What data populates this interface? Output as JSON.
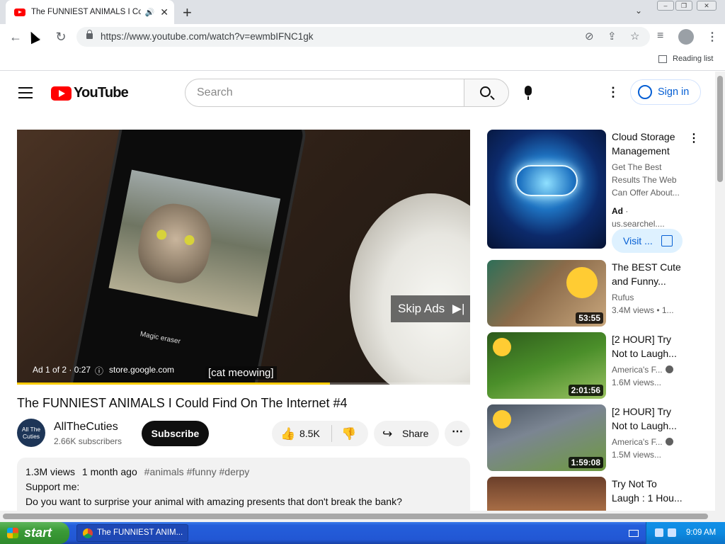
{
  "browser": {
    "tab_title": "The FUNNIEST ANIMALS I Could Find On The Internet #4",
    "url": "https://www.youtube.com/watch?v=ewmbIFNC1gk",
    "reading_list_label": "Reading list"
  },
  "header": {
    "logo_text": "YouTube",
    "search_placeholder": "Search",
    "sign_in_label": "Sign in"
  },
  "player": {
    "ad_info": "Ad 1 of 2 · 0:27",
    "ad_domain": "store.google.com",
    "skip_label": "Skip Ads",
    "caption": "[cat meowing]",
    "phone_text": "Magic eraser",
    "progress_fraction": 0.69
  },
  "video": {
    "title": "The FUNNIEST ANIMALS I Could Find On The Internet #4",
    "channel_name": "AllTheCuties",
    "channel_avatar_text": "All The Cuties",
    "subscribers": "2.66K subscribers",
    "subscribe_label": "Subscribe",
    "likes": "8.5K",
    "share_label": "Share"
  },
  "description": {
    "views": "1.3M views",
    "age": "1 month ago",
    "tags": "#animals #funny #derpy",
    "line1": "Support me:",
    "line2": "Do you want to surprise your animal with amazing presents that don't break the bank?"
  },
  "sidebar": {
    "ad": {
      "title": "Cloud Storage Management",
      "body": "Get The Best Results The Web Can Offer About...",
      "ad_label": "Ad",
      "domain": "us.searchel....",
      "visit_label": "Visit ..."
    },
    "recommendations": [
      {
        "title": "The BEST Cute and Funny...",
        "channel": "Rufus",
        "meta": "3.4M views  • 1...",
        "duration": "53:55",
        "verified": false
      },
      {
        "title": "[2 HOUR] Try Not to Laugh...",
        "channel": "America's F...",
        "meta": "1.6M views...",
        "duration": "2:01:56",
        "verified": true
      },
      {
        "title": "[2 HOUR] Try Not to Laugh...",
        "channel": "America's F...",
        "meta": "1.5M views...",
        "duration": "1:59:08",
        "verified": true
      },
      {
        "title": "Try Not To Laugh : 1 Hou...",
        "channel": "",
        "meta": "",
        "duration": "",
        "verified": false
      }
    ]
  },
  "taskbar": {
    "start_label": "start",
    "task_title": "The FUNNIEST ANIM...",
    "clock": "9:09 AM"
  }
}
